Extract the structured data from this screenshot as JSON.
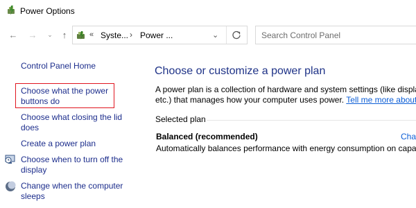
{
  "window": {
    "title": "Power Options"
  },
  "nav": {
    "back_icon": "arrow-left-icon",
    "forward_icon": "arrow-right-icon",
    "recent_icon": "chevron-down-icon",
    "up_icon": "arrow-up-icon",
    "back_glyph": "←",
    "forward_glyph": "→",
    "recent_glyph": "⌄",
    "up_glyph": "↑"
  },
  "address": {
    "overflow_glyph": "«",
    "crumb1": "Syste...",
    "sep_glyph": "›",
    "crumb2": "Power ...",
    "dropdown_glyph": "⌄"
  },
  "search": {
    "placeholder": "Search Control Panel"
  },
  "sidebar": {
    "home": "Control Panel Home",
    "items": [
      {
        "label": "Choose what the power buttons do",
        "highlighted": true
      },
      {
        "label": "Choose what closing the lid does"
      },
      {
        "label": "Create a power plan"
      },
      {
        "label": "Choose when to turn off the display",
        "icon": "display-clock-icon"
      },
      {
        "label": "Change when the computer sleeps",
        "icon": "moon-icon"
      }
    ]
  },
  "main": {
    "heading": "Choose or customize a power plan",
    "description_line1": "A power plan is a collection of hardware and system settings (like display",
    "description_line2": "etc.) that manages how your computer uses power.",
    "tell_more": "Tell me more about",
    "selected_plan_label": "Selected plan",
    "plan": {
      "name": "Balanced (recommended)",
      "change": "Cha",
      "description": "Automatically balances performance with energy consumption on capa"
    }
  },
  "colors": {
    "link": "#1c2d8c",
    "heading": "#1e3287",
    "highlight_border": "#e0141e",
    "hyperlink": "#0b5dd6"
  }
}
